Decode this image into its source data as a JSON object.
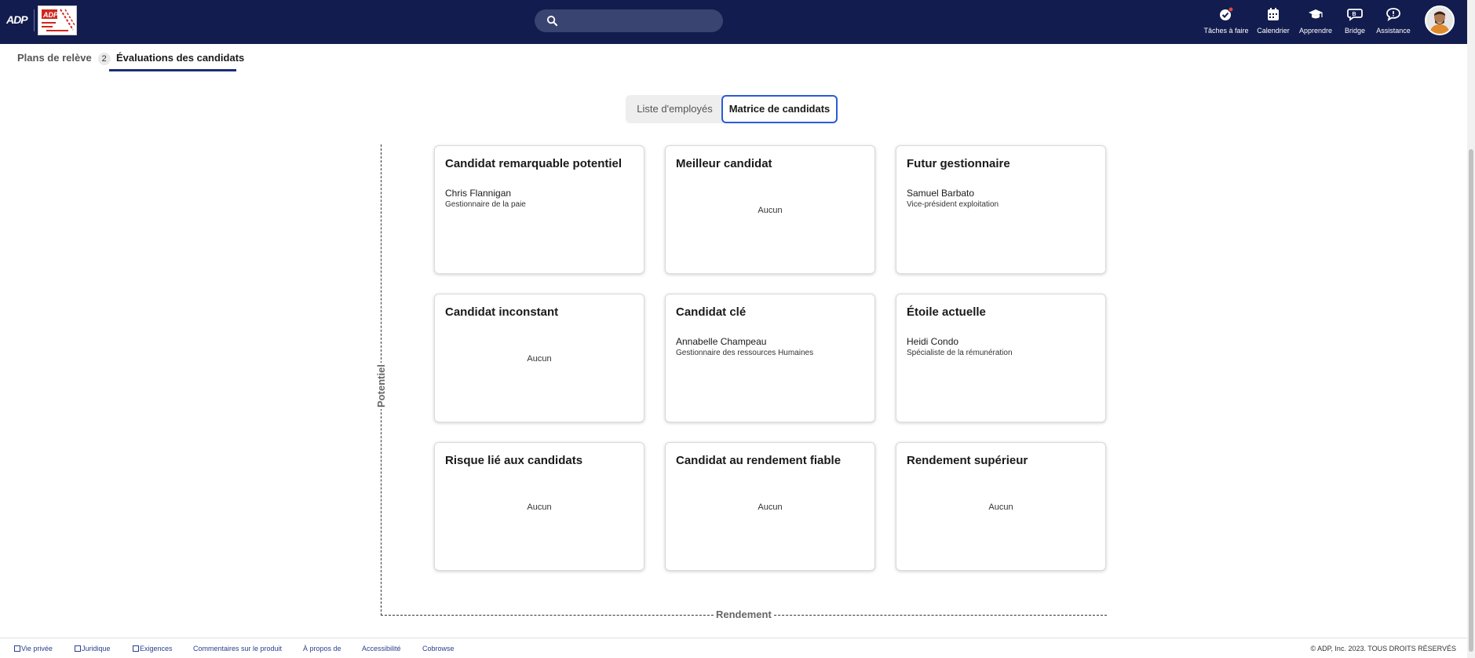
{
  "header": {
    "search_placeholder": "",
    "nav": [
      {
        "label": "Tâches à faire",
        "icon": "check-badge-icon"
      },
      {
        "label": "Calendrier",
        "icon": "calendar-icon"
      },
      {
        "label": "Apprendre",
        "icon": "graduation-cap-icon"
      },
      {
        "label": "Bridge",
        "icon": "bridge-chat-icon"
      },
      {
        "label": "Assistance",
        "icon": "chat-bubble-icon"
      }
    ],
    "brand_color": "#121c4e"
  },
  "tabs": [
    {
      "label": "Plans de relève",
      "count": "2"
    },
    {
      "label": "Évaluations des candidats"
    }
  ],
  "view_toggle": {
    "options": [
      "Liste d'employés",
      "Matrice de candidats"
    ],
    "selected": "Matrice de candidats"
  },
  "matrix": {
    "y_axis_label": "Potentiel",
    "x_axis_label": "Rendement",
    "cells": [
      {
        "title": "Candidat remarquable potentiel",
        "name": "Chris Flannigan",
        "role": "Gestionnaire de la paie"
      },
      {
        "title": "Meilleur candidat",
        "none": "Aucun"
      },
      {
        "title": "Futur gestionnaire",
        "name": "Samuel Barbato",
        "role": "Vice-président exploitation"
      },
      {
        "title": "Candidat inconstant",
        "none": "Aucun"
      },
      {
        "title": "Candidat clé",
        "name": "Annabelle Champeau",
        "role": "Gestionnaire des ressources Humaines"
      },
      {
        "title": "Étoile actuelle",
        "name": "Heidi Condo",
        "role": "Spécialiste de la rémunération"
      },
      {
        "title": "Risque lié aux candidats",
        "none": "Aucun"
      },
      {
        "title": "Candidat au rendement fiable",
        "none": "Aucun"
      },
      {
        "title": "Rendement supérieur",
        "none": "Aucun"
      }
    ]
  },
  "footer": {
    "links": [
      "Vie privée",
      "Juridique",
      "Exigences",
      "Commentaires sur le produit",
      "À propos de",
      "Accessibilité",
      "Cobrowse"
    ],
    "copyright": "© ADP, Inc. 2023. TOUS DROITS RÉSERVÉS"
  }
}
